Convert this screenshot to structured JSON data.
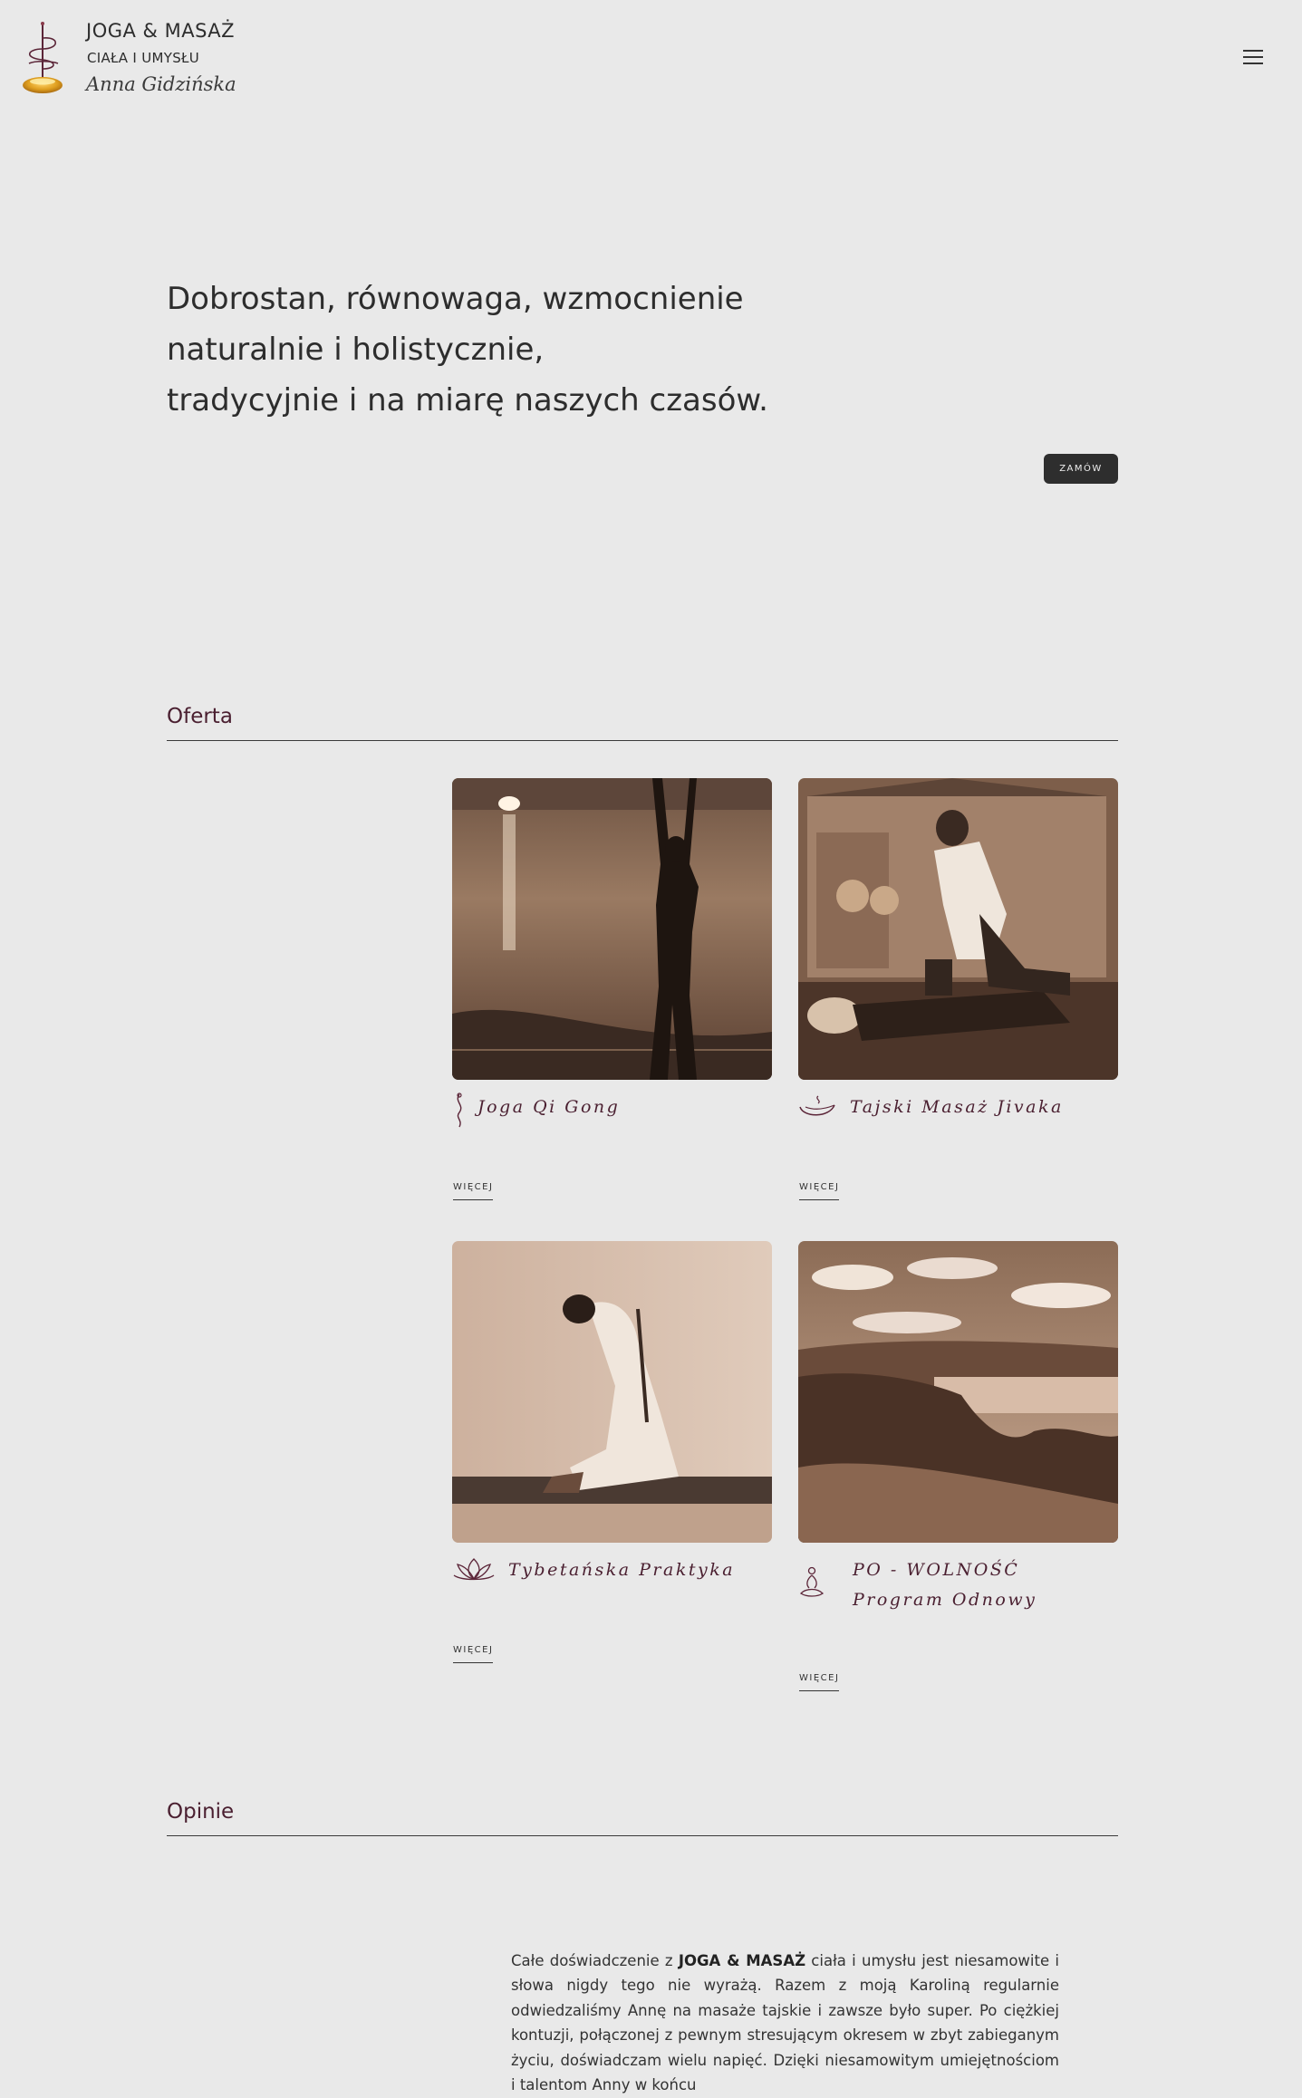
{
  "header": {
    "brand_name": "JOGA & MASAŻ",
    "brand_sub": "CIAŁA I UMYSŁU",
    "brand_author": "Anna Gidzińska",
    "logo_icon": "incense-stick-logo-icon",
    "menu_icon": "hamburger-menu-icon"
  },
  "hero": {
    "lines": [
      "Dobrostan, równowaga, wzmocnienie",
      "naturalnie i holistycznie,",
      "tradycyjnie i na miarę naszych czasów."
    ],
    "order_button": "ZAMÓW"
  },
  "offer": {
    "heading": "Oferta",
    "items": [
      {
        "title": "Joga Qi Gong",
        "icon": "energy-flow-icon",
        "image": "woman-yoga-sunset-sea-photo",
        "more": "WIĘCEJ"
      },
      {
        "title": "Tajski Masaż Jivaka",
        "icon": "singing-bowl-icon",
        "image": "thai-massage-session-photo",
        "more": "WIĘCEJ"
      },
      {
        "title": "Tybetańska Praktyka",
        "icon": "lotus-icon",
        "image": "tibetan-practice-backbend-photo",
        "more": "WIĘCEJ"
      },
      {
        "title": "PO - WOLNOŚĆ Program Odnowy",
        "icon": "meditation-figure-icon",
        "image": "lake-landscape-photo",
        "more": "WIĘCEJ"
      }
    ]
  },
  "testimonials": {
    "heading": "Opinie",
    "text_before": "Całe doświadczenie z ",
    "text_strong": "JOGA & MASAŻ",
    "text_after": " ciała i umysłu jest niesamowite i słowa nigdy tego nie wyrażą. Razem z moją Karoliną regularnie odwiedzaliśmy Annę na masaże tajskie i zawsze było super. Po ciężkiej kontuzji, połączonej z pewnym stresującym okresem w zbyt zabieganym życiu, doświadczam wielu napięć. Dzięki niesamowitym umiejętnościom i talentom Anny w końcu"
  },
  "colors": {
    "background": "#e9e9e9",
    "accent": "#4a1f30",
    "button": "#2e2e2e",
    "sepia": "#a57a5c"
  }
}
